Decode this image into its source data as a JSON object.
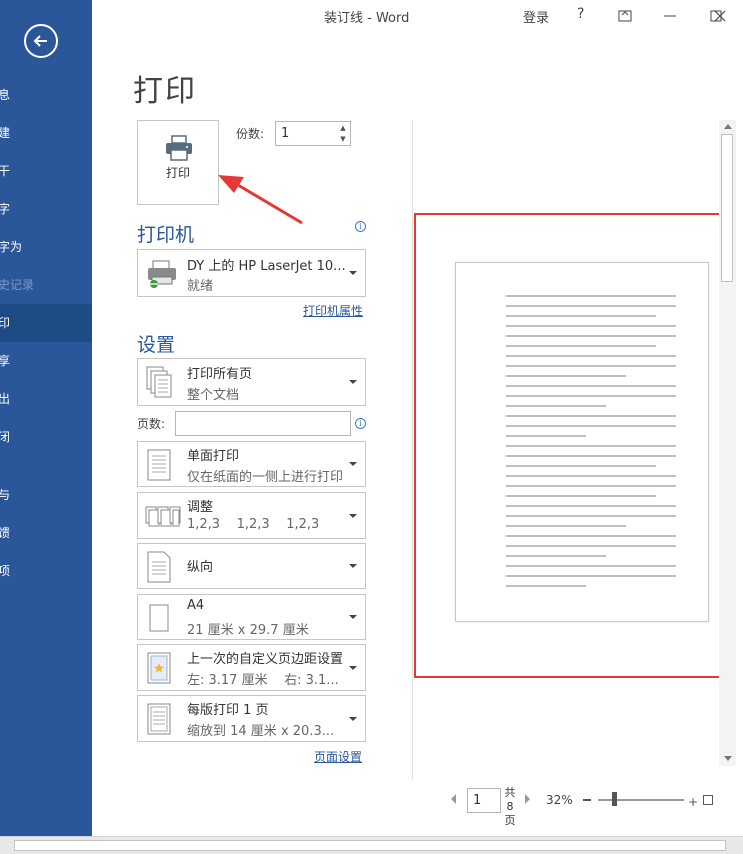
{
  "window": {
    "title": "装订线  -  Word",
    "signin": "登录",
    "help": "?"
  },
  "sidebar": {
    "items": [
      {
        "label": "息"
      },
      {
        "label": "建"
      },
      {
        "label": "干"
      },
      {
        "label": "字"
      },
      {
        "label": "字为"
      },
      {
        "label": "史记录"
      },
      {
        "label": "印"
      },
      {
        "label": "享"
      },
      {
        "label": "出"
      },
      {
        "label": "闭"
      },
      {
        "label": "与"
      },
      {
        "label": "馈"
      },
      {
        "label": "项"
      }
    ]
  },
  "page": {
    "heading": "打印"
  },
  "print_button": {
    "label": "打印"
  },
  "copies": {
    "label": "份数:",
    "value": "1"
  },
  "printer": {
    "section_title": "打印机",
    "name": "DY 上的 HP LaserJet 10...",
    "status": "就绪",
    "properties_link": "打印机属性"
  },
  "settings": {
    "section_title": "设置",
    "range": {
      "line1": "打印所有页",
      "line2": "整个文档"
    },
    "pages": {
      "label": "页数:",
      "placeholder": ""
    },
    "sides": {
      "line1": "单面打印",
      "line2": "仅在纸面的一侧上进行打印"
    },
    "collate": {
      "line1": "调整",
      "line2": "1,2,3    1,2,3    1,2,3"
    },
    "orientation": {
      "line1": "纵向"
    },
    "paper": {
      "line1": "A4",
      "line2": "21 厘米 x 29.7 厘米"
    },
    "margins": {
      "line1": "上一次的自定义页边距设置",
      "line2": "左: 3.17 厘米    右: 3.1..."
    },
    "per_sheet": {
      "line1": "每版打印 1 页",
      "line2": "缩放到 14 厘米 x 20.3..."
    },
    "page_setup_link": "页面设置"
  },
  "preview": {
    "current_page": "1",
    "total_pages": "共8页",
    "zoom": "32%"
  },
  "colors": {
    "accent": "#2b579a",
    "highlight": "#e53935"
  }
}
